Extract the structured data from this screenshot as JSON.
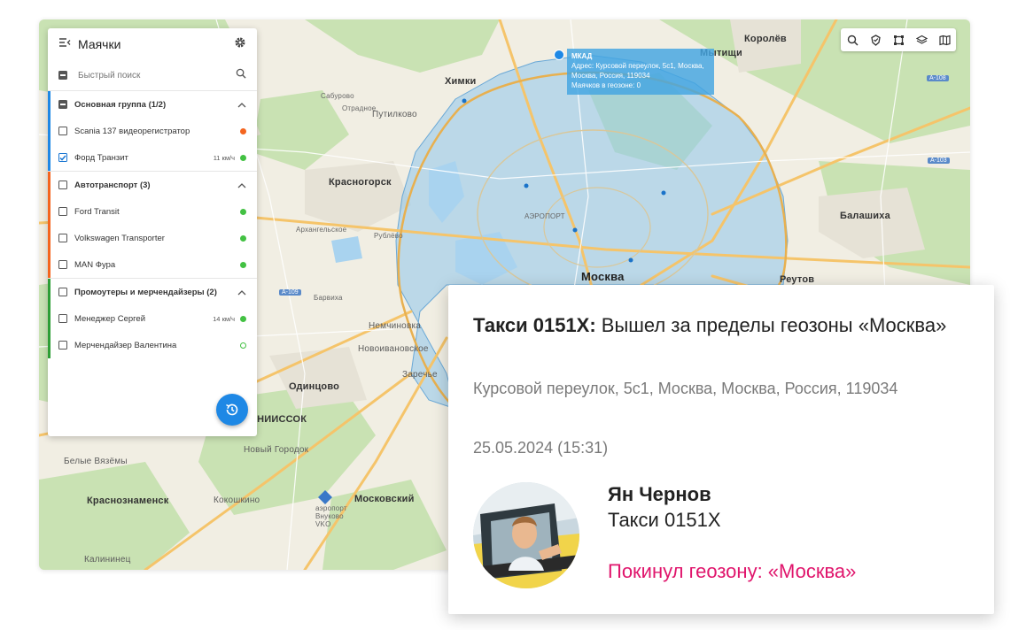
{
  "colors": {
    "accent": "#1e88e5",
    "geofence_fill": "#8ec6ec",
    "event_text": "#e0156c",
    "status_orange": "#f4651f",
    "status_green": "#43c143",
    "group_blue": "#1e88e5",
    "group_orange": "#f4651f",
    "group_green": "#2e9e36"
  },
  "map": {
    "toolbar": [
      "search-icon",
      "geofence-icon",
      "frame-icon",
      "layers-icon",
      "map-icon"
    ],
    "labels": {
      "khimki": "Химки",
      "mytishchi": "Мытищи",
      "korolev": "Королёв",
      "krasnogorsk": "Красногорск",
      "balashikha": "Балашиха",
      "moskva": "Москва",
      "reutov": "Реутов",
      "odintsovo": "Одинцово",
      "nemchinovka": "Немчиновка",
      "novoivanovskoe": "Новоивановское",
      "zarechye": "Заречье",
      "vnukovo_area": "ВНИИССОК",
      "belye_bazy": "Белые Вязёмы",
      "novy_gorodok": "Новый Городок",
      "krasnoznamensk": "Краснознаменск",
      "kokoshkino": "Кокошкино",
      "moskovsky": "Московский",
      "kalininets": "Калининец",
      "putilkovo": "Путилково",
      "otradnoe": "Отрадное",
      "sabuorovo": "Сабурово",
      "arkhangelskoe": "Архангельское",
      "rublevo": "Рублёво",
      "barvikha": "Барвиха",
      "aeroport": "АЭРОПОРТ",
      "vnukovo_airport": "аэропорт Внуково VKO"
    },
    "geofence_tooltip": {
      "title": "МКАД",
      "address": "Адрес: Курсовой переулок, 5с1, Москва, Москва, Россия, 119034",
      "beacons": "Маячков в геозоне: 0"
    }
  },
  "panel": {
    "title": "Маячки",
    "search_placeholder": "Быстрый поиск",
    "groups": [
      {
        "name": "Основная группа (1/2)",
        "items": [
          {
            "name": "Scania 137 видеорегистратор",
            "speed": "",
            "status": "orange",
            "checked": false
          },
          {
            "name": "Форд Транзит",
            "speed": "11 км/ч",
            "status": "green",
            "checked": true
          }
        ]
      },
      {
        "name": "Автотранспорт (3)",
        "items": [
          {
            "name": "Ford Transit",
            "speed": "",
            "status": "green",
            "checked": false
          },
          {
            "name": "Volkswagen Transporter",
            "speed": "",
            "status": "green",
            "checked": false
          },
          {
            "name": "MAN Фура",
            "speed": "",
            "status": "green",
            "checked": false
          }
        ]
      },
      {
        "name": "Промоутеры и мерчендайзеры (2)",
        "items": [
          {
            "name": "Менеджер Сергей",
            "speed": "14 км/ч",
            "status": "green",
            "checked": false
          },
          {
            "name": "Мерчендайзер Валентина",
            "speed": "",
            "status": "green-hollow",
            "checked": false
          }
        ]
      }
    ]
  },
  "notification": {
    "headline_bold": "Такси 0151X:",
    "headline_rest": " Вышел за пределы геозоны «Москва»",
    "address": "Курсовой переулок, 5с1, Москва, Москва, Россия, 119034",
    "datetime": "25.05.2024 (15:31)",
    "driver_name": "Ян Чернов",
    "vehicle": "Такси 0151X",
    "event": "Покинул геозону: «Москва»"
  }
}
